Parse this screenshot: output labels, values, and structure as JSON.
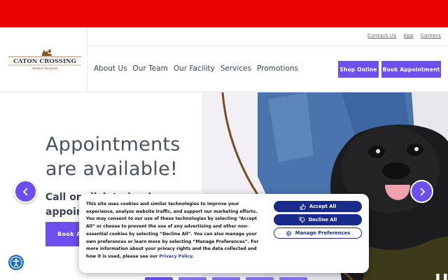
{
  "colors": {
    "top_bar": "#e60000",
    "accent": "#6d4ff0",
    "cookie_button": "#1a2a8c",
    "text_dark": "#4a5263",
    "accessibility": "#1e6fb8"
  },
  "logo": {
    "name": "CATON CROSSING",
    "tagline": "Animal Hospital",
    "icon": "cat-and-dog-silhouette-icon"
  },
  "utility_nav": [
    "Contact Us",
    "App",
    "Careers"
  ],
  "main_nav": [
    "About Us",
    "Our Team",
    "Our Facility",
    "Services",
    "Promotions"
  ],
  "header_ctas": {
    "shop": "Shop Online",
    "book": "Book Appointment"
  },
  "hero": {
    "title_line1": "Appointments",
    "title_line2": "are available!",
    "subtitle_line1": "Call or click to book",
    "subtitle_line2": "appointments",
    "button": "Book A",
    "prev_icon": "chevron-left-icon",
    "next_icon": "chevron-right-icon",
    "slides": 5,
    "active_slide": 1,
    "pause_icon": "pause-icon"
  },
  "cookie_banner": {
    "text": "This site uses cookies and similar technologies to improve your experience, analyze website traffic, and support our marketing efforts. You may consent to our use of these technologies by selecting “Accept All” or choose to prevent the use of any advertising and other non-essential cookies by selecting “Decline All”. You can also manage your own preferences or learn more by selecting “Manage Preferences”. For more information about your privacy rights and the data collected and how it is used, please see our ",
    "link": "Privacy Policy",
    "text_end": ".",
    "accept": "Accept All",
    "decline": "Decline All",
    "manage": "Manage Preferences"
  },
  "accessibility_icon": "accessibility-icon"
}
